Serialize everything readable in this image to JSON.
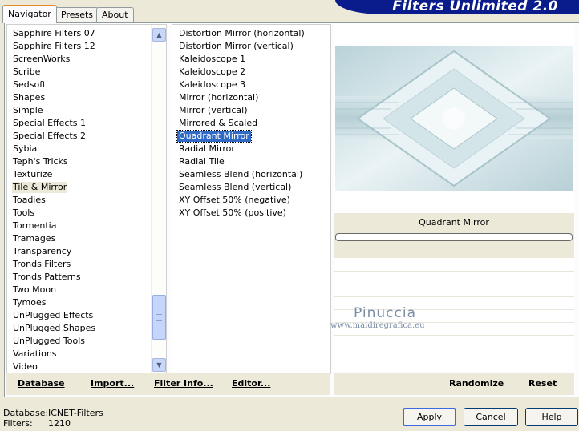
{
  "tabs": [
    "Navigator",
    "Presets",
    "About"
  ],
  "banner": "Filters Unlimited 2.0",
  "categories": [
    "Sapphire Filters 07",
    "Sapphire Filters 12",
    "ScreenWorks",
    "Scribe",
    "Sedsoft",
    "Shapes",
    "Simple",
    "Special Effects 1",
    "Special Effects 2",
    "Sybia",
    "Teph's Tricks",
    "Texturize",
    "Tile & Mirror",
    "Toadies",
    "Tools",
    "Tormentia",
    "Tramages",
    "Transparency",
    "Tronds Filters",
    "Tronds Patterns",
    "Two Moon",
    "Tymoes",
    "UnPlugged Effects",
    "UnPlugged Shapes",
    "UnPlugged Tools",
    "Variations",
    "Video"
  ],
  "selected_category": "Tile & Mirror",
  "filters": [
    "Distortion Mirror (horizontal)",
    "Distortion Mirror (vertical)",
    "Kaleidoscope 1",
    "Kaleidoscope 2",
    "Kaleidoscope 3",
    "Mirror (horizontal)",
    "Mirror (vertical)",
    "Mirrored & Scaled",
    "Quadrant Mirror",
    "Radial Mirror",
    "Radial Tile",
    "Seamless Blend (horizontal)",
    "Seamless Blend (vertical)",
    "XY Offset 50% (negative)",
    "XY Offset 50% (positive)"
  ],
  "selected_filter": "Quadrant Mirror",
  "preview": {
    "filter_name": "Quadrant Mirror"
  },
  "watermark": {
    "name": "Pinuccia",
    "url": "www.maidiregrafica.eu"
  },
  "bottom_links": {
    "database": "Database",
    "import": "Import...",
    "filter_info": "Filter Info...",
    "editor": "Editor...",
    "randomize": "Randomize",
    "reset": "Reset"
  },
  "status": {
    "database_label": "Database:",
    "database_value": "ICNET-Filters",
    "filters_label": "Filters:",
    "filters_value": "1210"
  },
  "buttons": {
    "apply": "Apply",
    "cancel": "Cancel",
    "help": "Help"
  },
  "colors": {
    "banner": "#0a1c8c",
    "selection": "#316ac5",
    "dialog_bg": "#ece9d8"
  }
}
